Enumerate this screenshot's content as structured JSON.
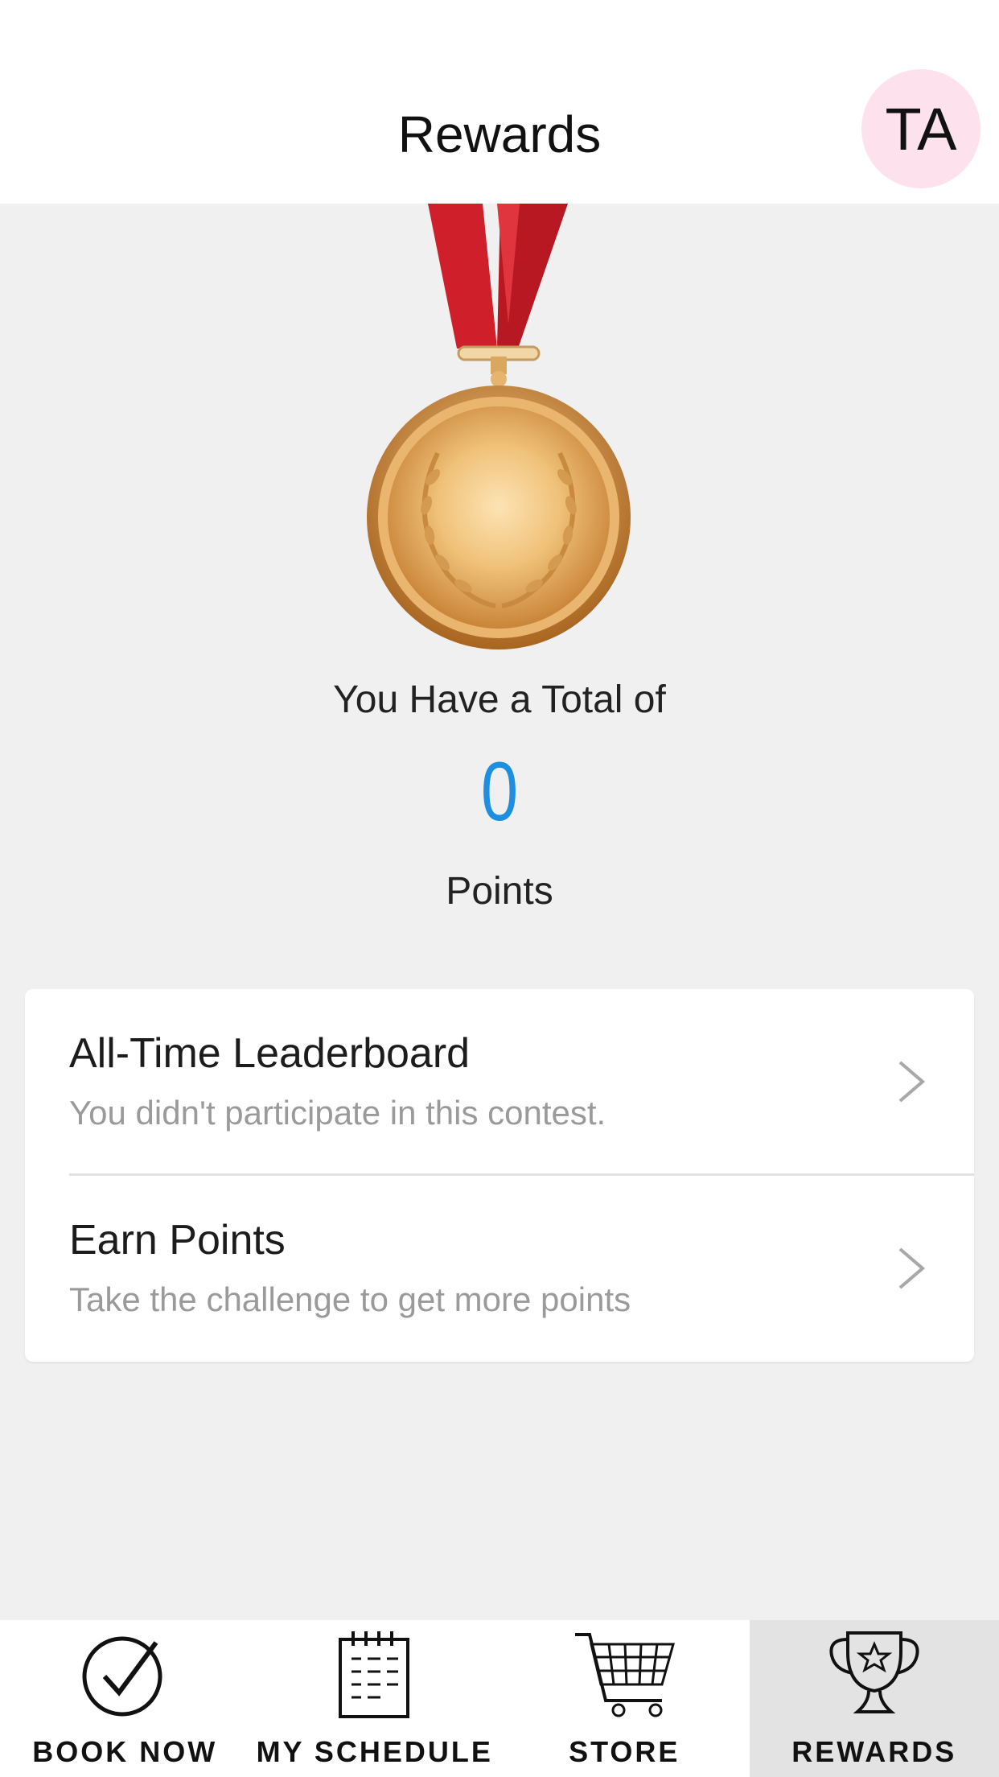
{
  "header": {
    "title": "Rewards",
    "avatar_initials": "TA"
  },
  "summary": {
    "total_label": "You Have a Total of",
    "points_value": "0",
    "points_label": "Points"
  },
  "list": {
    "items": [
      {
        "title": "All-Time Leaderboard",
        "subtitle": "You didn't participate in this contest."
      },
      {
        "title": "Earn Points",
        "subtitle": "Take the challenge to get more points"
      }
    ]
  },
  "tabs": [
    {
      "label": "BOOK NOW",
      "icon": "check-circle-icon"
    },
    {
      "label": "MY SCHEDULE",
      "icon": "notepad-icon"
    },
    {
      "label": "STORE",
      "icon": "cart-icon"
    },
    {
      "label": "REWARDS",
      "icon": "trophy-icon",
      "active": true
    }
  ],
  "colors": {
    "accent": "#1e8fe0",
    "avatar_bg": "#fde1ec",
    "background": "#f0f0f0",
    "active_tab_bg": "#e3e3e3",
    "ribbon": "#cf1f2a",
    "medal_gold": "#e0a35a"
  }
}
